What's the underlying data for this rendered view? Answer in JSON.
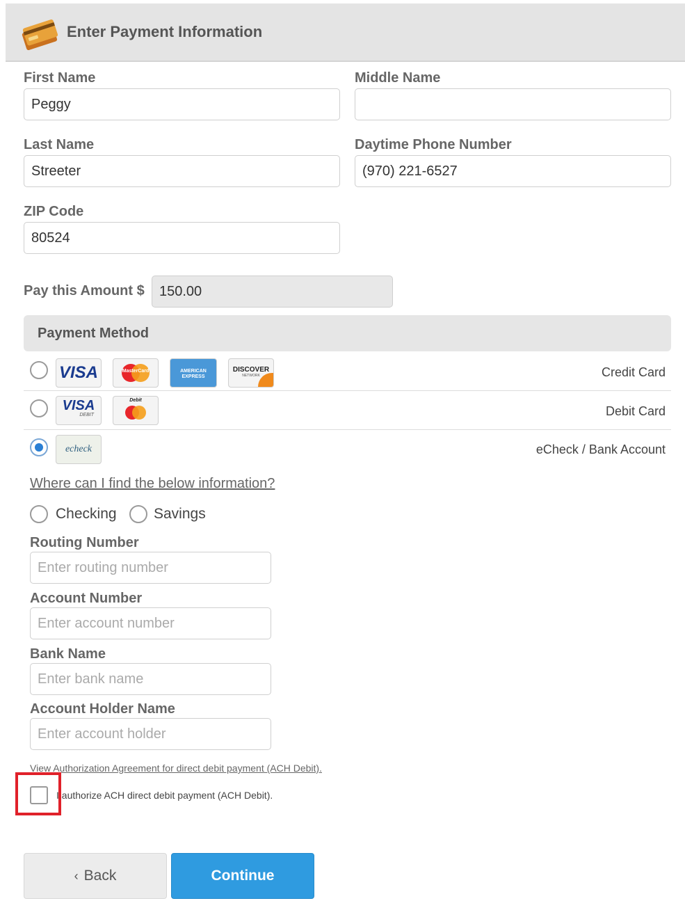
{
  "header": {
    "title": "Enter Payment Information",
    "icon": "credit-cards-icon"
  },
  "fields": {
    "first_name": {
      "label": "First Name",
      "value": "Peggy"
    },
    "middle_name": {
      "label": "Middle Name",
      "value": ""
    },
    "last_name": {
      "label": "Last Name",
      "value": "Streeter"
    },
    "phone": {
      "label": "Daytime Phone Number",
      "value": "(970) 221-6527"
    },
    "zip": {
      "label": "ZIP Code",
      "value": "80524"
    }
  },
  "amount": {
    "label": "Pay this Amount $",
    "value": "150.00"
  },
  "payment_method": {
    "title": "Payment Method",
    "options": [
      {
        "label": "Credit Card",
        "selected": false
      },
      {
        "label": "Debit Card",
        "selected": false
      },
      {
        "label": "eCheck / Bank Account",
        "selected": true
      }
    ],
    "card_logos": {
      "visa": "VISA",
      "mastercard": "MasterCard",
      "amex": "AMERICAN EXPRESS",
      "discover": "DISCOVER",
      "discover_sub": "NETWORK",
      "visa_debit": "VISA",
      "visa_debit_sub": "DEBIT",
      "debit_mc_top": "Debit",
      "echeck": "echeck"
    }
  },
  "echeck": {
    "help_link": "Where can I find the below information?",
    "account_types": [
      "Checking",
      "Savings"
    ],
    "routing": {
      "label": "Routing Number",
      "placeholder": "Enter routing number"
    },
    "account": {
      "label": "Account Number",
      "placeholder": "Enter account number"
    },
    "bank": {
      "label": "Bank Name",
      "placeholder": "Enter bank name"
    },
    "holder": {
      "label": "Account Holder Name",
      "placeholder": "Enter account holder"
    },
    "agreement_link": "View Authorization Agreement for direct debit payment (ACH Debit).",
    "authorize_label": "I authorize ACH direct debit payment (ACH Debit).",
    "authorize_checked": false
  },
  "buttons": {
    "back": "Back",
    "back_icon": "chevron-left-icon",
    "continue": "Continue"
  },
  "colors": {
    "accent": "#2f9be0",
    "highlight": "#e0212a",
    "radio_selected": "#2a7fd4"
  }
}
